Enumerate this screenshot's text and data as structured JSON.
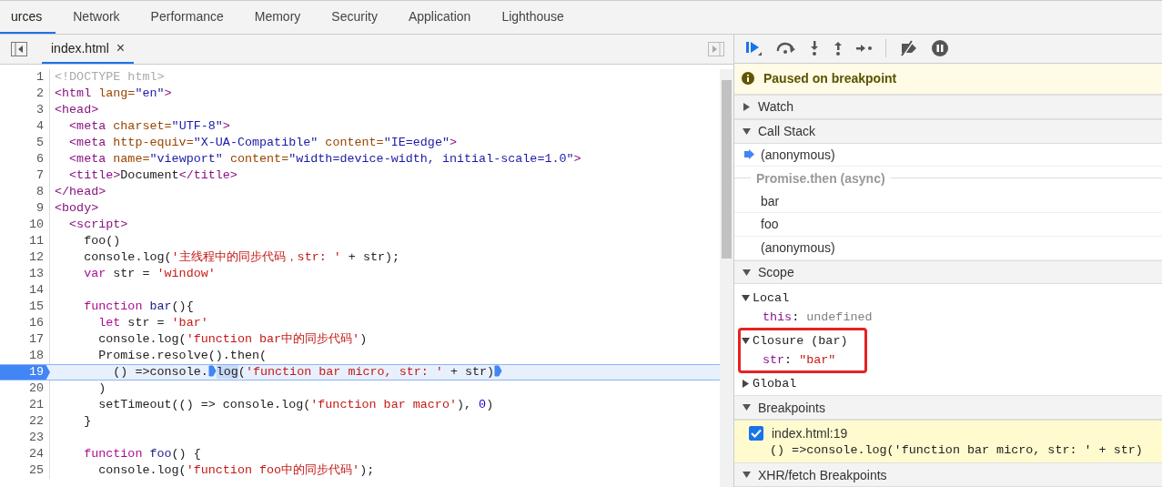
{
  "tabs": [
    {
      "label": "urces",
      "selected": true
    },
    {
      "label": "Network",
      "selected": false
    },
    {
      "label": "Performance",
      "selected": false
    },
    {
      "label": "Memory",
      "selected": false
    },
    {
      "label": "Security",
      "selected": false
    },
    {
      "label": "Application",
      "selected": false
    },
    {
      "label": "Lighthouse",
      "selected": false
    }
  ],
  "editor": {
    "file_tabs": [
      {
        "label": "index.html",
        "close": "×",
        "selected": true
      }
    ],
    "lines": [
      {
        "number": "1",
        "active": false,
        "tokens": [
          {
            "kind": "comment",
            "text": "<!DOCTYPE html>"
          }
        ]
      },
      {
        "number": "2",
        "active": false,
        "tokens": [
          {
            "kind": "tag",
            "text": "<html "
          },
          {
            "kind": "attr",
            "text": "lang="
          },
          {
            "kind": "val",
            "text": "\"en\""
          },
          {
            "kind": "tag",
            "text": ">"
          }
        ]
      },
      {
        "number": "3",
        "active": false,
        "tokens": [
          {
            "kind": "tag",
            "text": "<head>"
          }
        ]
      },
      {
        "number": "4",
        "active": false,
        "tokens": [
          {
            "kind": "tag",
            "text": "  <meta "
          },
          {
            "kind": "attr",
            "text": "charset="
          },
          {
            "kind": "val",
            "text": "\"UTF-8\""
          },
          {
            "kind": "tag",
            "text": ">"
          }
        ]
      },
      {
        "number": "5",
        "active": false,
        "tokens": [
          {
            "kind": "tag",
            "text": "  <meta "
          },
          {
            "kind": "attr",
            "text": "http-equiv="
          },
          {
            "kind": "val",
            "text": "\"X-UA-Compatible\" "
          },
          {
            "kind": "attr",
            "text": "content="
          },
          {
            "kind": "val",
            "text": "\"IE=edge\""
          },
          {
            "kind": "tag",
            "text": ">"
          }
        ]
      },
      {
        "number": "6",
        "active": false,
        "tokens": [
          {
            "kind": "tag",
            "text": "  <meta "
          },
          {
            "kind": "attr",
            "text": "name="
          },
          {
            "kind": "val",
            "text": "\"viewport\" "
          },
          {
            "kind": "attr",
            "text": "content="
          },
          {
            "kind": "val",
            "text": "\"width=device-width, initial-scale=1.0\""
          },
          {
            "kind": "tag",
            "text": ">"
          }
        ]
      },
      {
        "number": "7",
        "active": false,
        "tokens": [
          {
            "kind": "tag",
            "text": "  <title>"
          },
          {
            "kind": "plain",
            "text": "Document"
          },
          {
            "kind": "tag",
            "text": "</title>"
          }
        ]
      },
      {
        "number": "8",
        "active": false,
        "tokens": [
          {
            "kind": "tag",
            "text": "</head>"
          }
        ]
      },
      {
        "number": "9",
        "active": false,
        "tokens": [
          {
            "kind": "tag",
            "text": "<body>"
          }
        ]
      },
      {
        "number": "10",
        "active": false,
        "tokens": [
          {
            "kind": "tag",
            "text": "  <script>"
          }
        ]
      },
      {
        "number": "11",
        "active": false,
        "tokens": [
          {
            "kind": "plain",
            "text": "    foo()"
          }
        ]
      },
      {
        "number": "12",
        "active": false,
        "tokens": [
          {
            "kind": "plain",
            "text": "    console.log("
          },
          {
            "kind": "str",
            "text": "'主线程中的同步代码，str: '"
          },
          {
            "kind": "plain",
            "text": " + str);"
          }
        ]
      },
      {
        "number": "13",
        "active": false,
        "tokens": [
          {
            "kind": "kw",
            "text": "    var"
          },
          {
            "kind": "plain",
            "text": " str = "
          },
          {
            "kind": "str",
            "text": "'window'"
          }
        ]
      },
      {
        "number": "14",
        "active": false
      },
      {
        "number": "15",
        "active": false,
        "tokens": [
          {
            "kind": "kw",
            "text": "    function "
          },
          {
            "kind": "def",
            "text": "bar"
          },
          {
            "kind": "plain",
            "text": "(){"
          }
        ]
      },
      {
        "number": "16",
        "active": false,
        "tokens": [
          {
            "kind": "kw",
            "text": "      let"
          },
          {
            "kind": "plain",
            "text": " str = "
          },
          {
            "kind": "str",
            "text": "'bar'"
          }
        ]
      },
      {
        "number": "17",
        "active": false,
        "tokens": [
          {
            "kind": "plain",
            "text": "      console.log("
          },
          {
            "kind": "str",
            "text": "'function bar中的同步代码'"
          },
          {
            "kind": "plain",
            "text": ")"
          }
        ]
      },
      {
        "number": "18",
        "active": false,
        "tokens": [
          {
            "kind": "plain",
            "text": "      Promise.resolve().then("
          }
        ]
      },
      {
        "number": "19",
        "active": true,
        "tokens": [
          {
            "kind": "plain",
            "text": "        () =>console."
          },
          {
            "kind": "marker"
          },
          {
            "kind": "sel",
            "text": "log"
          },
          {
            "kind": "plain",
            "text": "("
          },
          {
            "kind": "str",
            "text": "'function bar micro, str: '"
          },
          {
            "kind": "plain",
            "text": " + str)"
          },
          {
            "kind": "marker"
          }
        ]
      },
      {
        "number": "20",
        "active": false,
        "tokens": [
          {
            "kind": "plain",
            "text": "      )"
          }
        ]
      },
      {
        "number": "21",
        "active": false,
        "tokens": [
          {
            "kind": "plain",
            "text": "      setTimeout(() => console.log("
          },
          {
            "kind": "str",
            "text": "'function bar macro'"
          },
          {
            "kind": "plain",
            "text": "), "
          },
          {
            "kind": "num",
            "text": "0"
          },
          {
            "kind": "plain",
            "text": ")"
          }
        ]
      },
      {
        "number": "22",
        "active": false,
        "tokens": [
          {
            "kind": "plain",
            "text": "    }"
          }
        ]
      },
      {
        "number": "23",
        "active": false
      },
      {
        "number": "24",
        "active": false,
        "tokens": [
          {
            "kind": "kw",
            "text": "    function "
          },
          {
            "kind": "def",
            "text": "foo"
          },
          {
            "kind": "plain",
            "text": "() {"
          }
        ]
      },
      {
        "number": "25",
        "active": false,
        "tokens": [
          {
            "kind": "plain",
            "text": "      console.log("
          },
          {
            "kind": "str",
            "text": "'function foo中的同步代码'"
          },
          {
            "kind": "plain",
            "text": ");"
          }
        ]
      }
    ]
  },
  "debugger": {
    "status": "Paused on breakpoint",
    "sections": [
      {
        "label": "Watch",
        "expanded": false
      },
      {
        "kind": "call_stack",
        "label": "Call Stack",
        "expanded": true,
        "frames": [
          {
            "kind": "frame",
            "label": "(anonymous)",
            "selected": true
          },
          {
            "kind": "async",
            "label": "Promise.then (async)"
          },
          {
            "kind": "frame",
            "label": "bar",
            "selected": false
          },
          {
            "kind": "frame",
            "label": "foo",
            "selected": false
          },
          {
            "kind": "frame",
            "label": "(anonymous)",
            "selected": false
          }
        ]
      },
      {
        "kind": "scope",
        "label": "Scope",
        "expanded": true,
        "items": [
          {
            "name": "Local",
            "expanded": true,
            "highlighted": false,
            "children": [
              {
                "name": "this",
                "separator": ":",
                "value": "undefined",
                "kind": "undefined"
              }
            ]
          },
          {
            "name": "Closure (bar)",
            "expanded": true,
            "highlighted": true,
            "children": [
              {
                "name": "str",
                "separator": ":",
                "value": "\"bar\"",
                "kind": "string"
              }
            ]
          },
          {
            "name": "Global",
            "expanded": false,
            "highlighted": false
          }
        ]
      },
      {
        "kind": "breakpoints",
        "label": "Breakpoints",
        "expanded": true,
        "breakpoints": [
          {
            "location": "index.html:19",
            "code": "() =>console.log('function bar micro, str: ' + str)",
            "checked": true
          }
        ]
      },
      {
        "label": "XHR/fetch Breakpoints",
        "expanded": true
      }
    ]
  }
}
